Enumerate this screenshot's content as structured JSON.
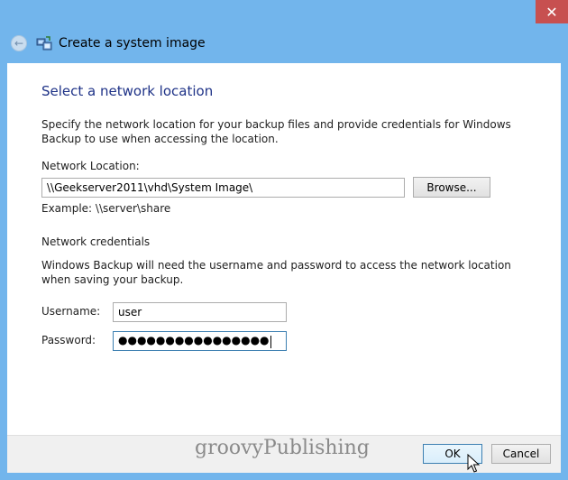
{
  "window": {
    "title": "Create a system image",
    "close_glyph": "✕",
    "back_glyph": "←"
  },
  "page": {
    "heading": "Select a network location",
    "intro": "Specify the network location for your backup files and provide credentials for Windows Backup to use when accessing the location.",
    "network_location_label": "Network Location:",
    "network_location_value": "\\\\Geekserver2011\\vhd\\System Image\\",
    "browse_label": "Browse...",
    "example": "Example: \\\\server\\share",
    "credentials_heading": "Network credentials",
    "credentials_desc": "Windows Backup will need the username and password to access the network location when saving your backup.",
    "username_label": "Username:",
    "username_value": "user",
    "password_label": "Password:",
    "password_value": "●●●●●●●●●●●●●●●●"
  },
  "footer": {
    "watermark": "groovyPublishing",
    "ok_label": "OK",
    "cancel_label": "Cancel"
  },
  "colors": {
    "frame": "#72b5ec",
    "heading": "#1e3287",
    "close": "#c75050"
  }
}
